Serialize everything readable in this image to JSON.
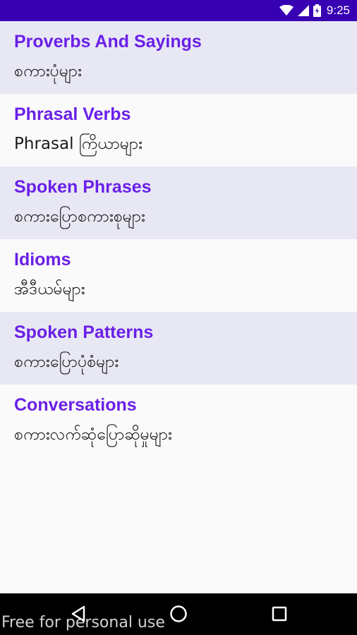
{
  "status_bar": {
    "time": "9:25",
    "icons": [
      "wifi-icon",
      "cell-signal-icon",
      "battery-icon"
    ]
  },
  "menu": {
    "items": [
      {
        "title": "Proverbs And Sayings",
        "subtitle": "စကားပုံများ"
      },
      {
        "title": "Phrasal Verbs",
        "subtitle": "Phrasal ကြိယာများ"
      },
      {
        "title": "Spoken Phrases",
        "subtitle": "စကားပြောစကားစုများ"
      },
      {
        "title": "Idioms",
        "subtitle": "အီဒီယမ်များ"
      },
      {
        "title": "Spoken Patterns",
        "subtitle": "စကားပြောပုံစံများ"
      },
      {
        "title": "Conversations",
        "subtitle": "စကားလက်ဆုံပြောဆိုမှုများ"
      }
    ]
  },
  "navigation": {
    "buttons": [
      "back-icon",
      "home-icon",
      "recents-icon"
    ]
  },
  "watermark": "Free for personal use",
  "colors": {
    "status_bar": "#3700b3",
    "title_text": "#6a1fe8",
    "shaded_row": "#e8e8f4",
    "plain_row": "#fafafa",
    "nav_bar": "#000000"
  }
}
